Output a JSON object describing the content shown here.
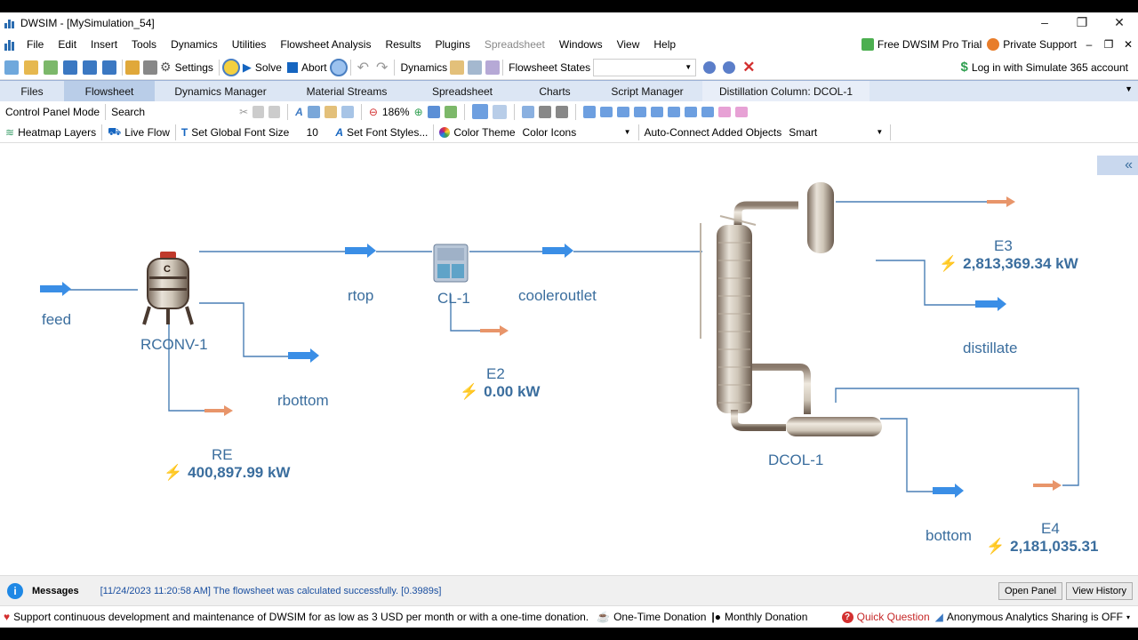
{
  "window": {
    "title": "DWSIM - [MySimulation_54]",
    "controls": [
      "–",
      "❐",
      "✕"
    ]
  },
  "menu": {
    "items": [
      "File",
      "Edit",
      "Insert",
      "Tools",
      "Dynamics",
      "Utilities",
      "Flowsheet Analysis",
      "Results",
      "Plugins",
      "Spreadsheet",
      "Windows",
      "View",
      "Help"
    ],
    "right": {
      "pro_trial": "Free DWSIM Pro Trial",
      "support": "Private Support"
    }
  },
  "toolbar1": {
    "settings": "Settings",
    "solve": "Solve",
    "abort": "Abort",
    "dynamics": "Dynamics",
    "flowsheet_states": "Flowsheet States",
    "login": "Log in with Simulate 365 account"
  },
  "tabs": [
    "Files",
    "Flowsheet",
    "Dynamics Manager",
    "Material Streams",
    "Spreadsheet",
    "Charts",
    "Script Manager",
    "Distillation Column: DCOL-1"
  ],
  "toolbar2": {
    "mode": "Control Panel Mode",
    "search": "Search",
    "zoom": "186%"
  },
  "toolbar3": {
    "heatmap": "Heatmap Layers",
    "liveflow": "Live Flow",
    "global_font": "Set Global Font Size",
    "font_size": "10",
    "font_styles": "Set Font Styles...",
    "color_theme": "Color Theme",
    "color_theme_value": "Color Icons",
    "autoconnect": "Auto-Connect Added Objects",
    "autoconnect_value": "Smart"
  },
  "flowsheet": {
    "feed": "feed",
    "rconv": "RCONV-1",
    "rtop": "rtop",
    "cl": "CL-1",
    "cooleroutlet": "cooleroutlet",
    "rbottom": "rbottom",
    "re": "RE",
    "re_value": "400,897.99 kW",
    "e2": "E2",
    "e2_value": "0.00 kW",
    "e3": "E3",
    "e3_value": "2,813,369.34 kW",
    "distillate": "distillate",
    "dcol": "DCOL-1",
    "bottom": "bottom",
    "e4": "E4",
    "e4_value": "2,181,035.31",
    "reactor_letter": "C"
  },
  "messages": {
    "label": "Messages",
    "text": "[11/24/2023 11:20:58 AM] The flowsheet was calculated successfully. [0.3989s]",
    "open_panel": "Open Panel",
    "view_history": "View History"
  },
  "status": {
    "donation_text": "Support continuous development and maintenance of DWSIM for as low as 3 USD per month or with a one-time donation.",
    "one_time": "One-Time Donation",
    "monthly": "Monthly Donation",
    "quick_question": "Quick Question",
    "analytics": "Anonymous Analytics Sharing is OFF"
  },
  "colors": {
    "stream_blue": "#3a8ee6",
    "energy_orange": "#e8956a",
    "label_blue": "#3b6e9e",
    "tab_bg": "#dce6f4",
    "tab_active": "#b9cde8"
  }
}
